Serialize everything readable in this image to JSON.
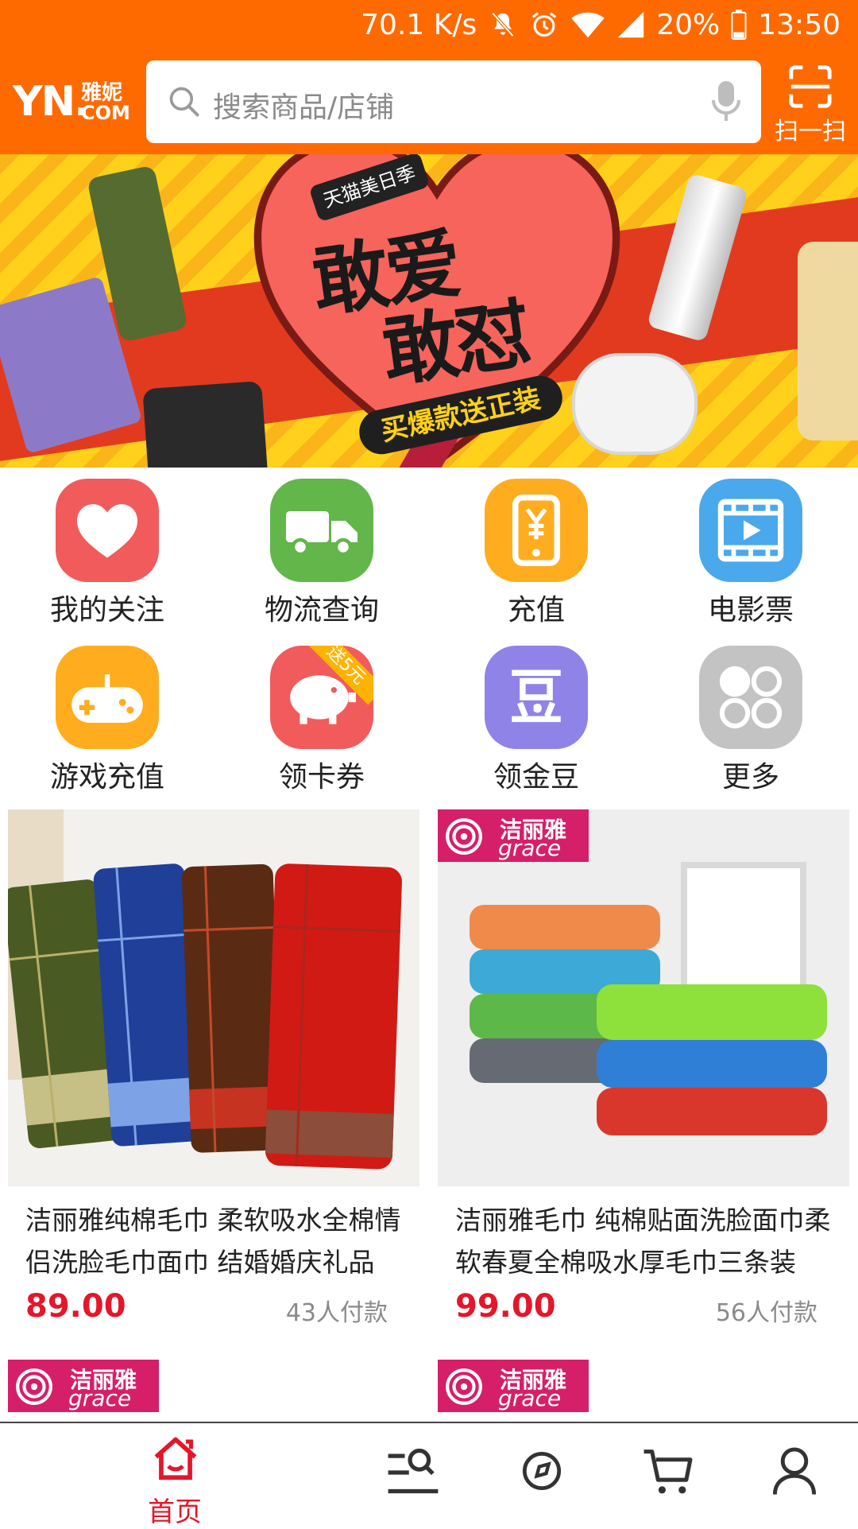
{
  "status_bar": {
    "net_speed": "70.1 K/s",
    "battery": "20%",
    "time": "13:50"
  },
  "header": {
    "logo_text": "YN.",
    "logo_cn": "雅妮",
    "logo_com": "COM",
    "search_placeholder": "搜索商品/店铺",
    "scan_label": "扫一扫"
  },
  "banner": {
    "tag": "天猫美日季",
    "headline_1": "敢爱",
    "headline_2": "敢怼",
    "slogan": "买爆款送正装",
    "slide_count": 7,
    "active_slide": 2
  },
  "quick_links": [
    {
      "label": "我的关注",
      "color": "#f25b5b",
      "icon": "heart-icon"
    },
    {
      "label": "物流查询",
      "color": "#62b64a",
      "icon": "truck-icon"
    },
    {
      "label": "充值",
      "color": "#ffad1f",
      "icon": "phone-yuan-icon"
    },
    {
      "label": "电影票",
      "color": "#4aa8ec",
      "icon": "film-icon"
    },
    {
      "label": "游戏充值",
      "color": "#ffad1f",
      "icon": "gamepad-icon"
    },
    {
      "label": "领卡券",
      "color": "#f25b5b",
      "icon": "piggy-bank-icon",
      "ribbon": "送5元"
    },
    {
      "label": "领金豆",
      "color": "#8f83e8",
      "icon": "bean-icon"
    },
    {
      "label": "更多",
      "color": "#c3c3c3",
      "icon": "more-grid-icon"
    }
  ],
  "products": [
    {
      "title": "洁丽雅纯棉毛巾 柔软吸水全棉情侣洗脸毛巾面巾 结婚婚庆礼品",
      "price": "89.00",
      "sold": "43人付款",
      "brand_badge": false
    },
    {
      "title": "洁丽雅毛巾 纯棉贴面洗脸面巾柔软春夏全棉吸水厚毛巾三条装",
      "price": "99.00",
      "sold": "56人付款",
      "brand_badge": true
    }
  ],
  "brand": {
    "name_cn": "洁丽雅",
    "name_en": "grace",
    "color": "#d61f69"
  },
  "bottom_nav": [
    {
      "label": "首页",
      "icon": "home-icon",
      "active": true
    },
    {
      "label": "",
      "icon": "category-search-icon",
      "active": false
    },
    {
      "label": "",
      "icon": "compass-icon",
      "active": false
    },
    {
      "label": "",
      "icon": "cart-icon",
      "active": false
    },
    {
      "label": "",
      "icon": "profile-icon",
      "active": false
    }
  ],
  "colors": {
    "primary": "#ff6a00",
    "price": "#e4162a"
  }
}
